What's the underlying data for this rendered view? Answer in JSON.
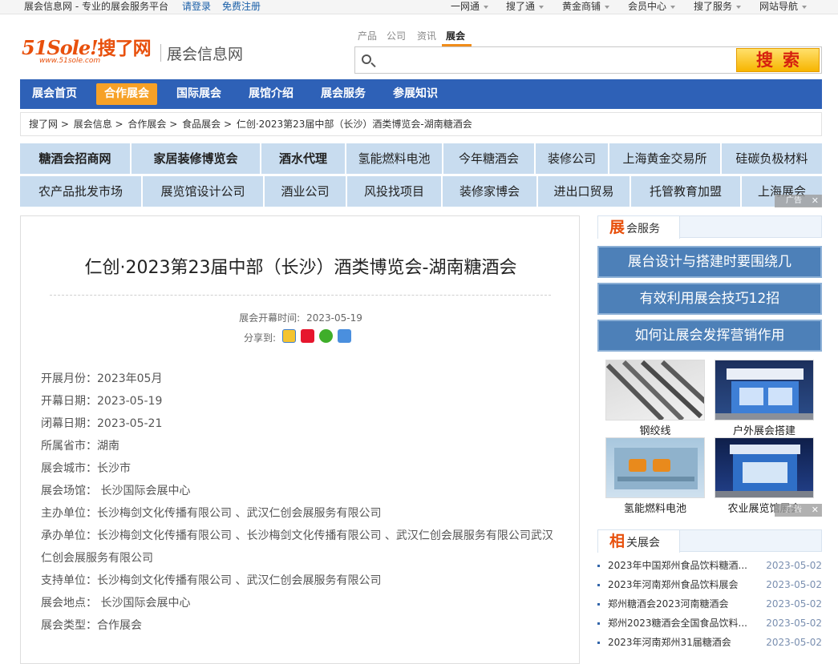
{
  "topbar": {
    "site": "展会信息网 - 专业的展会服务平台",
    "login": "请登录",
    "register": "免费注册",
    "nav": [
      "一网通",
      "搜了通",
      "黄金商铺",
      "会员中心",
      "搜了服务",
      "网站导航"
    ]
  },
  "header": {
    "logo_main": "51Sole!",
    "logo_cn": "搜了网",
    "logo_sub": "www.51sole.com",
    "site_name": "展会信息网"
  },
  "search": {
    "tabs": [
      "产品",
      "公司",
      "资讯",
      "展会"
    ],
    "active_tab": "展会",
    "placeholder": "",
    "button": "搜索"
  },
  "mainnav": [
    "展会首页",
    "合作展会",
    "国际展会",
    "展馆介绍",
    "展会服务",
    "参展知识"
  ],
  "mainnav_active": "合作展会",
  "breadcrumb": [
    "搜了网",
    "展会信息",
    "合作展会",
    "食品展会",
    "仁创·2023第23届中部（长沙）酒类博览会-湖南糖酒会"
  ],
  "ads_row1": [
    "糖酒会招商网",
    "家居装修博览会",
    "酒水代理",
    "氢能燃料电池",
    "今年糖酒会",
    "装修公司",
    "上海黄金交易所",
    "硅碳负极材料"
  ],
  "ads_row2": [
    "农产品批发市场",
    "展览馆设计公司",
    "酒业公司",
    "风投找项目",
    "装修家博会",
    "进出口贸易",
    "托管教育加盟",
    "上海展会"
  ],
  "ad_tag": "广告",
  "article": {
    "title": "仁创·2023第23届中部（长沙）酒类博览会-湖南糖酒会",
    "date_label": "展会开幕时间:",
    "date": "2023-05-19",
    "share_label": "分享到:",
    "info": [
      "开展月份：2023年05月",
      "开幕日期：2023-05-19",
      "闭幕日期：2023-05-21",
      "所属省市：湖南",
      "展会城市：长沙市",
      "展会场馆： 长沙国际会展中心",
      "主办单位：长沙梅剑文化传播有限公司 、武汉仁创会展服务有限公司",
      "承办单位：长沙梅剑文化传播有限公司 、长沙梅剑文化传播有限公司 、武汉仁创会展服务有限公司武汉仁创会展服务有限公司",
      "支持单位：长沙梅剑文化传播有限公司 、武汉仁创会展服务有限公司",
      "展会地点： 长沙国际会展中心",
      "展会类型：合作展会"
    ]
  },
  "sidebar": {
    "service_head_big": "展",
    "service_head_rest": "会服务",
    "services": [
      "展台设计与搭建时要围绕几",
      "有效利用展会技巧12招",
      "如何让展会发挥营销作用"
    ],
    "thumbs": [
      "钢绞线",
      "户外展会搭建",
      "氢能燃料电池",
      "农业展览馆展会"
    ],
    "related_head_big": "相",
    "related_head_rest": "关展会",
    "related": [
      {
        "title": "2023年中国郑州食品饮料糖酒...",
        "date": "2023-05-02"
      },
      {
        "title": "2023年河南郑州食品饮料展会",
        "date": "2023-05-02"
      },
      {
        "title": "郑州糖酒会2023河南糖酒会",
        "date": "2023-05-02"
      },
      {
        "title": "郑州2023糖酒会全国食品饮料...",
        "date": "2023-05-02"
      },
      {
        "title": "2023年河南郑州31届糖酒会",
        "date": "2023-05-02"
      }
    ]
  }
}
